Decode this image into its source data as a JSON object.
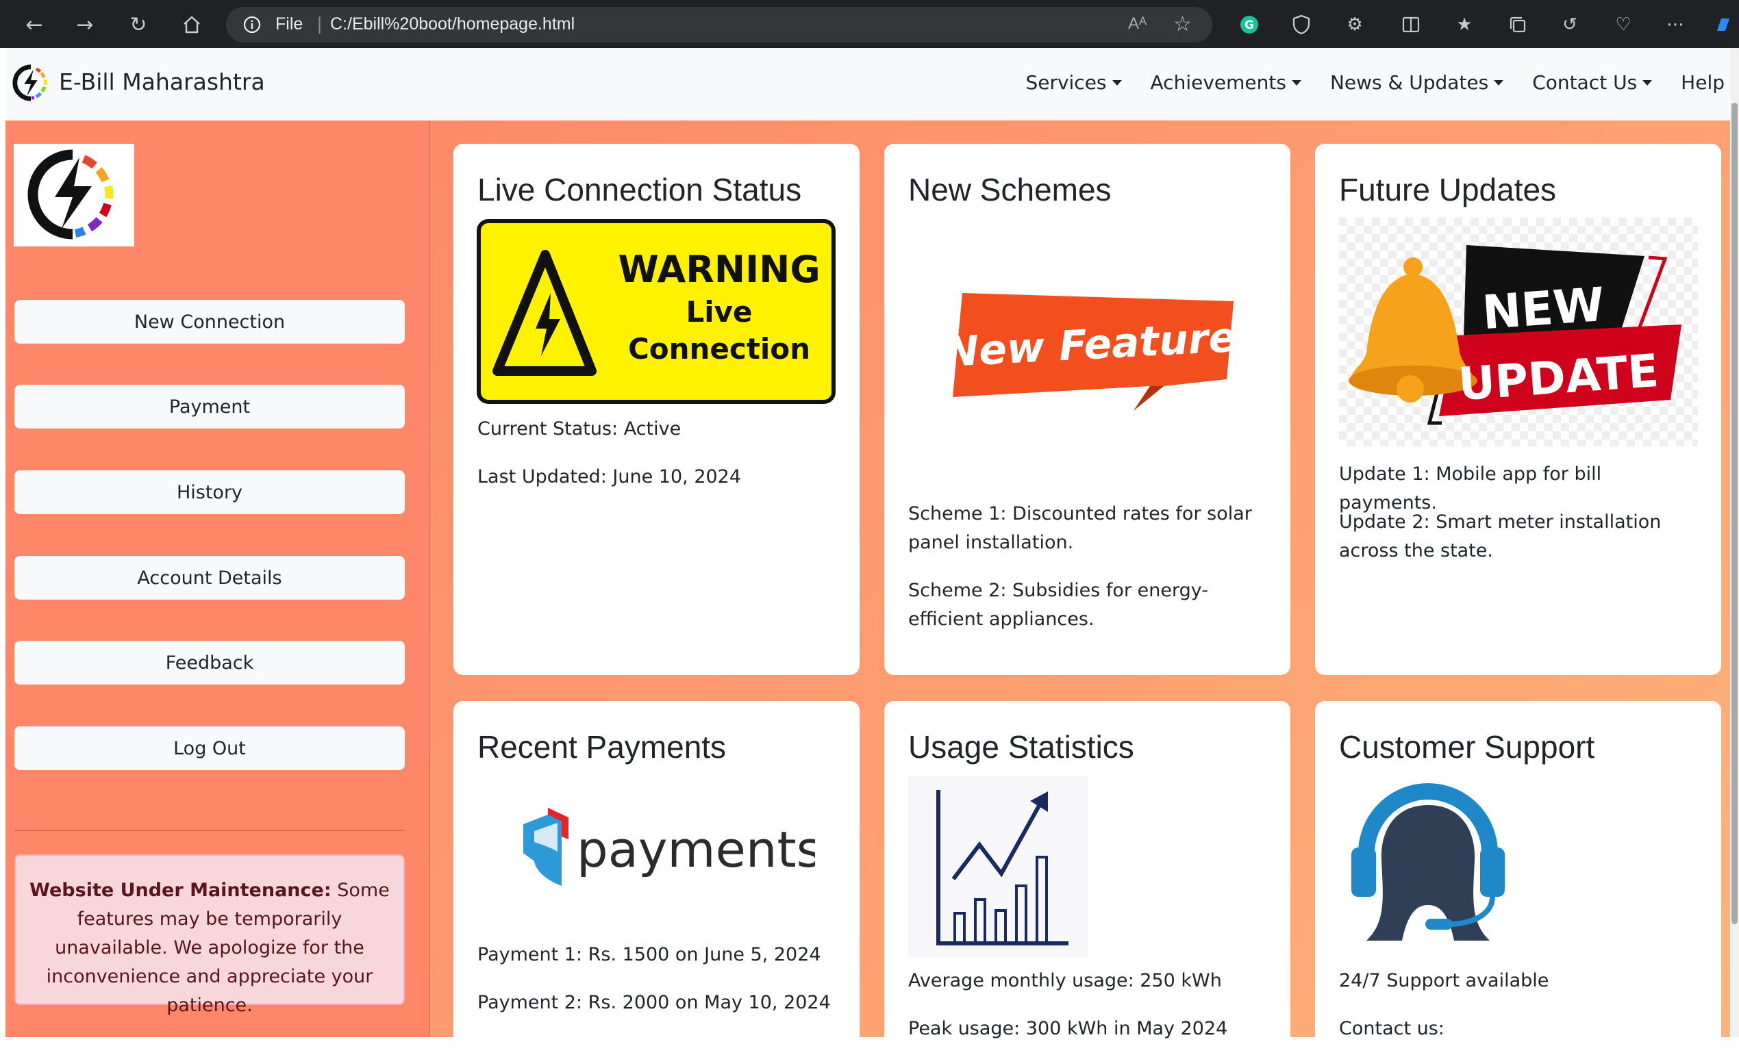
{
  "browser": {
    "file_label": "File",
    "separator": "|",
    "url": "C:/Ebill%20boot/homepage.html",
    "read_aloud": "Aᴬ"
  },
  "navbar": {
    "brand": "E-Bill Maharashtra",
    "links": [
      {
        "label": "Services",
        "dropdown": true
      },
      {
        "label": "Achievements",
        "dropdown": true
      },
      {
        "label": "News & Updates",
        "dropdown": true
      },
      {
        "label": "Contact Us",
        "dropdown": true
      },
      {
        "label": "Help",
        "dropdown": false
      }
    ]
  },
  "sidebar": {
    "buttons": [
      "New Connection",
      "Payment",
      "History",
      "Account Details",
      "Feedback",
      "Log Out"
    ],
    "alert": {
      "title": "Website Under Maintenance:",
      "text": "Some features may be temporarily unavailable. We apologize for the inconvenience and appreciate your patience."
    }
  },
  "cards": {
    "live": {
      "title": "Live Connection Status",
      "sign_warning": "WARNING",
      "sign_line1": "Live",
      "sign_line2": "Connection",
      "status": "Current Status: Active",
      "updated": "Last Updated: June 10, 2024"
    },
    "schemes": {
      "title": "New Schemes",
      "banner": "New Feature",
      "item1": "Scheme 1: Discounted rates for solar panel installation.",
      "item2": "Scheme 2: Subsidies for energy-efficient appliances."
    },
    "future": {
      "title": "Future Updates",
      "badge_line1": "NEW",
      "badge_line2": "UPDATE",
      "item1": "Update 1: Mobile app for bill payments.",
      "item2": "Update 2: Smart meter installation across the state."
    },
    "payments": {
      "title": "Recent Payments",
      "logo_text": "payments",
      "item1": "Payment 1: Rs. 1500 on June 5, 2024",
      "item2": "Payment 2: Rs. 2000 on May 10, 2024"
    },
    "usage": {
      "title": "Usage Statistics",
      "item1": "Average monthly usage: 250 kWh",
      "item2": "Peak usage: 300 kWh in May 2024"
    },
    "support": {
      "title": "Customer Support",
      "item1": "24/7 Support available",
      "item2": "Contact us:"
    }
  },
  "colors": {
    "sidebar": "#fd8768",
    "alert_bg": "#f8d7da",
    "warning_yellow": "#fff200",
    "feature_orange": "#f24e1e",
    "update_red": "#d0021b",
    "support_blue": "#1e88c9",
    "chart_navy": "#1b2a5e"
  }
}
